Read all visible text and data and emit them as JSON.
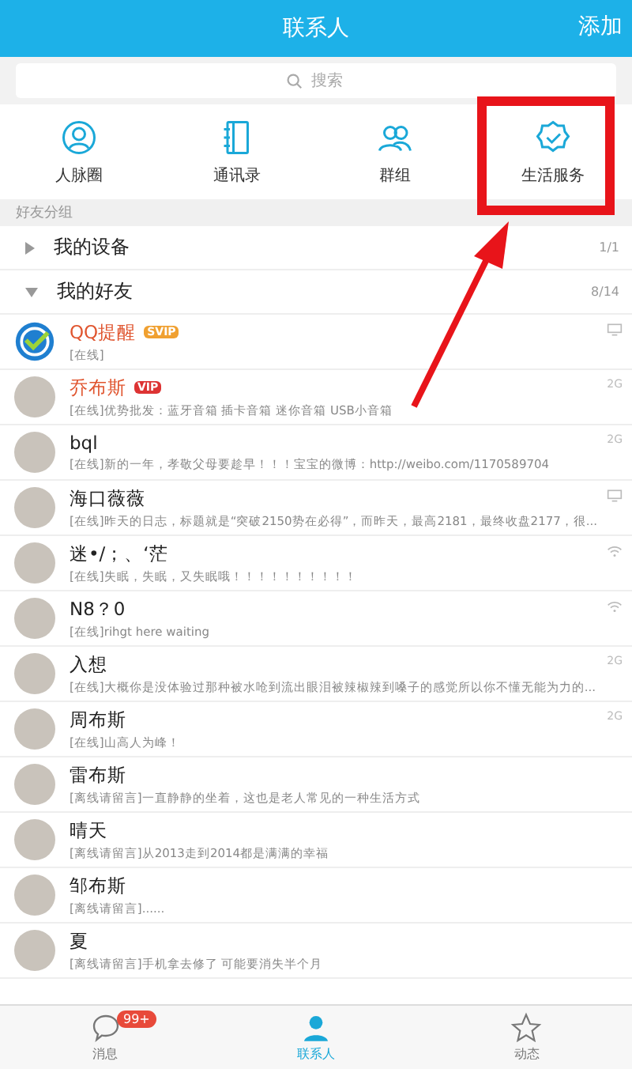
{
  "top_bar": {
    "title": "联系人",
    "action": "添加"
  },
  "search": {
    "placeholder": "搜索"
  },
  "shortcuts": [
    {
      "kind": "circle",
      "label": "人脉圈"
    },
    {
      "kind": "book",
      "label": "通讯录"
    },
    {
      "kind": "group",
      "label": "群组"
    },
    {
      "kind": "badge",
      "label": "生活服务"
    }
  ],
  "section_label": "好友分组",
  "groups": [
    {
      "name": "我的设备",
      "count": "1/1",
      "expanded": false
    },
    {
      "name": "我的好友",
      "count": "8/14",
      "expanded": true
    }
  ],
  "friends": [
    {
      "kind": "logo",
      "name": "QQ提醒",
      "vip": true,
      "tag": {
        "kind": "gold",
        "text": "SVIP"
      },
      "status": "[在线]",
      "device": {
        "kind": "pc"
      }
    },
    {
      "kind": "photo",
      "name": "乔布斯",
      "vip": true,
      "tag": {
        "kind": "red",
        "text": "VIP"
      },
      "status": "[在线]",
      "message": "优势批发：蓝牙音箱 插卡音箱 迷你音箱 USB小音箱",
      "device": {
        "kind": "text",
        "text": "2G"
      }
    },
    {
      "kind": "photo",
      "name": "bql",
      "vip": false,
      "status": "[在线]",
      "message": "新的一年，孝敬父母要趁早！！！宝宝的微博：http://weibo.com/1170589704",
      "device": {
        "kind": "text",
        "text": "2G"
      }
    },
    {
      "kind": "photo",
      "name": "海口薇薇",
      "vip": false,
      "status": "[在线]",
      "message": "昨天的日志，标题就是“突破2150势在必得”，而昨天，最高2181，最终收盘2177，很...",
      "device": {
        "kind": "pc"
      }
    },
    {
      "kind": "photo",
      "name": "迷•/；、‘茫",
      "vip": false,
      "status": "[在线]",
      "message": "失眠，失眠，又失眠哦！！！！！！！！！！",
      "device": {
        "kind": "wifi"
      }
    },
    {
      "kind": "photo",
      "name": "N8？0",
      "vip": false,
      "status": "[在线]",
      "message": "rihgt here waiting",
      "device": {
        "kind": "wifi"
      }
    },
    {
      "kind": "photo",
      "name": "入想",
      "vip": false,
      "status": "[在线]",
      "message": "大概你是没体验过那种被水呛到流出眼泪被辣椒辣到嗓子的感觉所以你不懂无能为力的...",
      "device": {
        "kind": "text",
        "text": "2G"
      }
    },
    {
      "kind": "photo",
      "name": "周布斯",
      "vip": false,
      "status": "[在线]",
      "message": "山高人为峰！",
      "device": {
        "kind": "text",
        "text": "2G"
      }
    },
    {
      "kind": "photo",
      "name": "雷布斯",
      "vip": false,
      "status": "[离线请留言]",
      "message": "一直静静的坐着，这也是老人常见的一种生活方式"
    },
    {
      "kind": "photo",
      "name": "晴天",
      "vip": false,
      "status": "[离线请留言]",
      "message": "从2013走到2014都是满满的幸福"
    },
    {
      "kind": "photo",
      "name": "邹布斯",
      "vip": false,
      "status": "[离线请留言]",
      "message": "......"
    },
    {
      "kind": "photo",
      "name": "夏",
      "vip": false,
      "status": "[离线请留言]",
      "message": "手机拿去修了  可能要消失半个月"
    }
  ],
  "tab_bar": [
    {
      "kind": "chat",
      "label": "消息",
      "badge": "99+",
      "selected": false
    },
    {
      "kind": "person",
      "label": "联系人",
      "selected": true
    },
    {
      "kind": "star",
      "label": "动态",
      "selected": false
    }
  ]
}
